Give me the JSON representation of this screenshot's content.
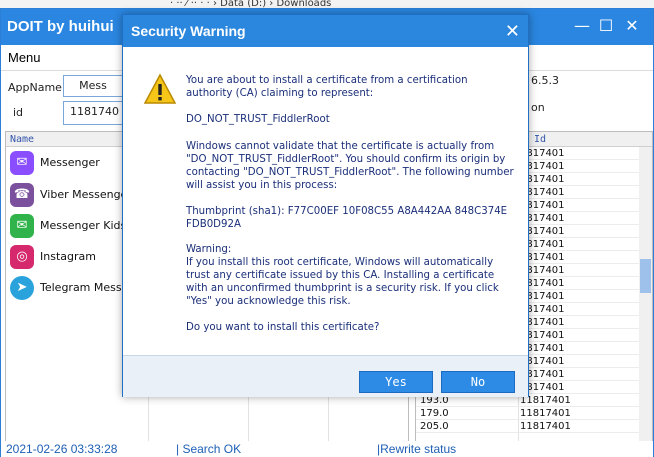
{
  "behind_window": {
    "path_text": "· ·· ⁄  ·· ·  ·  ›  Data (D:)  ›  Downloads"
  },
  "app": {
    "title": "DOIT by huihui",
    "window_buttons": {
      "minimize": "—",
      "maximize": "☐",
      "close": "✕"
    },
    "menu": "Menu",
    "fields": {
      "appname_label": "AppName",
      "appname_value": "Mess",
      "id_label": "id",
      "id_value": "1181740"
    },
    "right_partial": {
      "version": "6.5.3",
      "on": "on"
    },
    "list": {
      "header": "Name",
      "items": [
        {
          "name": "Messenger",
          "icon": "messenger-icon",
          "color": "#8a4dff"
        },
        {
          "name": "Viber Messenger:",
          "icon": "viber-icon",
          "color": "#7b519d"
        },
        {
          "name": "Messenger Kids",
          "icon": "messenger-kids-icon",
          "color": "#2fb34a"
        },
        {
          "name": "Instagram",
          "icon": "instagram-icon",
          "color": "#d6286c"
        },
        {
          "name": "Telegram Messen",
          "icon": "telegram-icon",
          "color": "#2aa3dd"
        }
      ]
    },
    "table": {
      "header_col2": "d Id",
      "rows": [
        {
          "c1": "",
          "c2": "1817401"
        },
        {
          "c1": "",
          "c2": "1817401"
        },
        {
          "c1": "",
          "c2": "1817401"
        },
        {
          "c1": "",
          "c2": "1817401"
        },
        {
          "c1": "",
          "c2": "1817401"
        },
        {
          "c1": "",
          "c2": "1817401"
        },
        {
          "c1": "",
          "c2": "1817401"
        },
        {
          "c1": "",
          "c2": "1817401"
        },
        {
          "c1": "",
          "c2": "1817401"
        },
        {
          "c1": "",
          "c2": "1817401"
        },
        {
          "c1": "",
          "c2": "1817401"
        },
        {
          "c1": "",
          "c2": "1817401"
        },
        {
          "c1": "",
          "c2": "1817401"
        },
        {
          "c1": "",
          "c2": "1817401"
        },
        {
          "c1": "",
          "c2": "1817401"
        },
        {
          "c1": "",
          "c2": "1817401"
        },
        {
          "c1": "",
          "c2": "1817401"
        },
        {
          "c1": "",
          "c2": "1817401"
        },
        {
          "c1": "",
          "c2": "1817401"
        },
        {
          "c1": "193.0",
          "c2": "11817401"
        },
        {
          "c1": "179.0",
          "c2": "11817401"
        },
        {
          "c1": "205.0",
          "c2": "11817401"
        }
      ]
    },
    "status": {
      "time": "2021-02-26 03:33:28",
      "search": "| Search OK",
      "rewrite": "|Rewrite status"
    }
  },
  "dialog": {
    "title": "Security Warning",
    "close": "✕",
    "p1": "You are about to install a certificate from a certification authority (CA) claiming to represent:",
    "p2": "DO_NOT_TRUST_FiddlerRoot",
    "p3": "Windows cannot validate that the certificate is actually from \"DO_NOT_TRUST_FiddlerRoot\". You should confirm its origin by contacting \"DO_NOT_TRUST_FiddlerRoot\". The following number will assist you in this process:",
    "p4": "Thumbprint (sha1): F77C00EF 10F08C55 A8A442AA 848C374E FDB0D92A",
    "p5": "Warning:\nIf you install this root certificate, Windows will automatically trust any certificate issued by this CA. Installing a certificate with an unconfirmed thumbprint is a security risk. If you click \"Yes\" you acknowledge this risk.",
    "p6": "Do you want to install this certificate?",
    "yes": "Yes",
    "no": "No"
  },
  "colors": {
    "accent": "#2a86e0",
    "dialog_text": "#1b2f7a",
    "status_text": "#1e5fb4"
  }
}
